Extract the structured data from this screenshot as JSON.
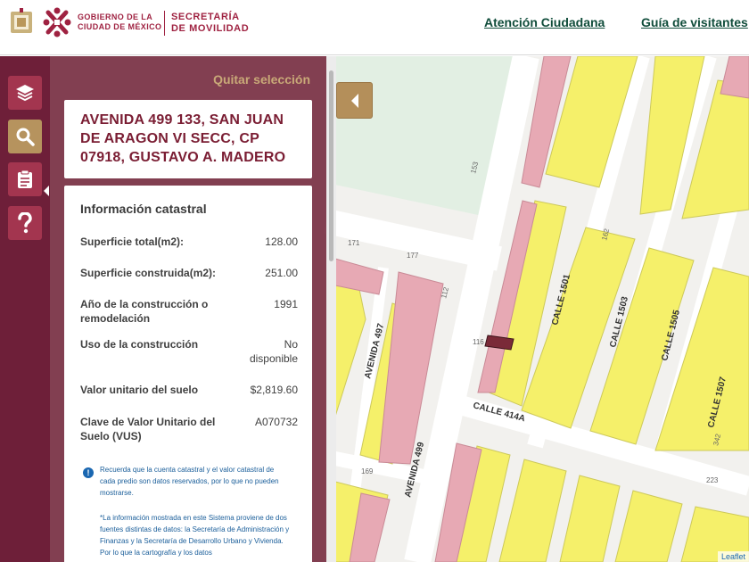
{
  "header": {
    "gov_line1": "GOBIERNO DE LA",
    "gov_line2": "CIUDAD DE MÉXICO",
    "sec_line1": "SECRETARÍA",
    "sec_line2": "DE MOVILIDAD",
    "nav": {
      "atencion": "Atención Ciudadana",
      "guia": "Guía de visitantes"
    },
    "icons": [
      "crest-icon",
      "cdmx-logo-icon"
    ]
  },
  "toolbar": {
    "buttons": [
      {
        "name": "layers",
        "icon": "layers-icon",
        "active": false
      },
      {
        "name": "search",
        "icon": "search-icon",
        "active": true
      },
      {
        "name": "report",
        "icon": "clipboard-icon",
        "active": false
      },
      {
        "name": "help",
        "icon": "question-icon",
        "active": false
      }
    ]
  },
  "panel": {
    "clear_selection": "Quitar selección",
    "address": "AVENIDA 499 133, SAN JUAN DE ARAGON VI SECC, CP 07918, GUSTAVO A. MADERO",
    "info": {
      "title": "Información catastral",
      "rows": [
        {
          "label": "Superficie total(m2):",
          "value": "128.00"
        },
        {
          "label": "Superficie construida(m2):",
          "value": "251.00"
        },
        {
          "label": "Año de la construcción o remodelación",
          "value": "1991"
        },
        {
          "label": "Uso de la construcción",
          "value": "No disponible"
        },
        {
          "label": "Valor unitario del suelo",
          "value": "$2,819.60"
        },
        {
          "label": "Clave de Valor Unitario del Suelo (VUS)",
          "value": "A070732"
        }
      ],
      "notice": "Recuerda que la cuenta catastral y el valor catastral de cada predio son datos reservados, por lo que no pueden mostrarse.",
      "disclaimer": "*La información mostrada en este Sistema proviene de dos fuentes distintas de datos: la Secretaría de Administración y Finanzas y la Secretaría de Desarrollo Urbano y Vivienda. Por lo que la cartografía y los datos"
    }
  },
  "map": {
    "attribution": "Leaflet",
    "labels": {
      "calle1501": "CALLE 1501",
      "calle1503": "CALLE 1503",
      "calle1505": "CALLE 1505",
      "calle1507": "CALLE 1507",
      "calle414a": "CALLE 414A",
      "avenida497": "AVENIDA 497",
      "avenida499": "AVENIDA 499",
      "n153": "153",
      "n171": "171",
      "n177": "177",
      "n116": "116",
      "n169": "169",
      "n223": "223",
      "n112": "112",
      "n162": "162",
      "n342": "342"
    },
    "colors": {
      "background": "#f2f1ee",
      "park": "#e2efe3",
      "residential": "#f5f06a",
      "commercial": "#e7a9b4",
      "selected": "#7a2a38",
      "street": "#ffffff"
    }
  }
}
